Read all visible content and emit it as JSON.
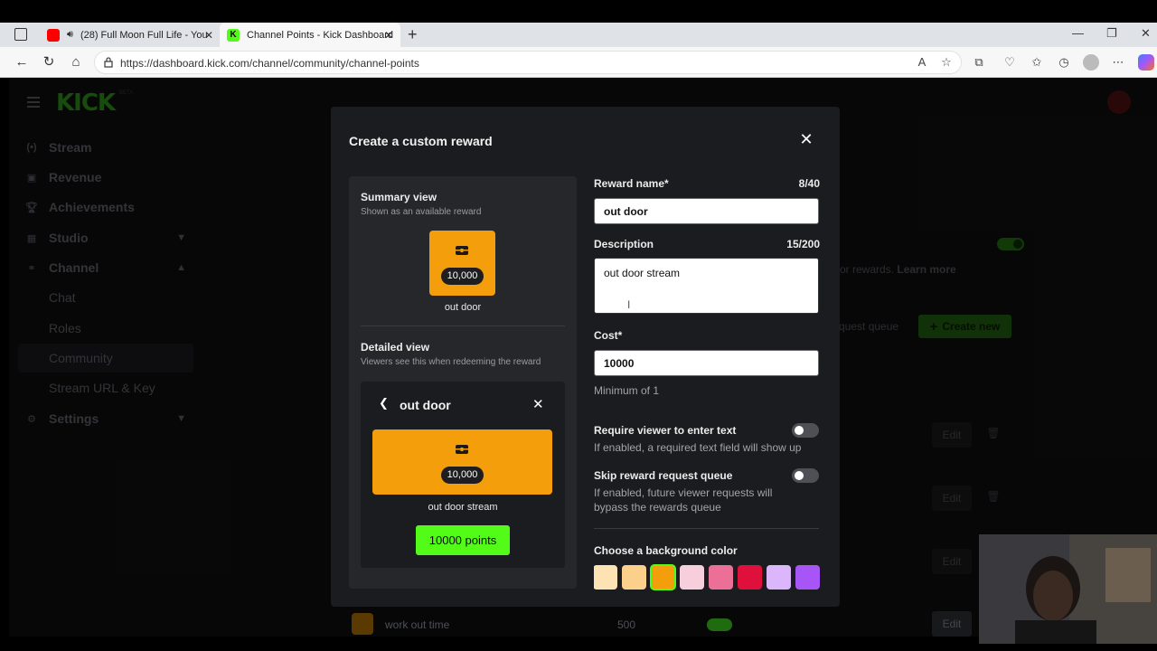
{
  "browser": {
    "tabs": [
      {
        "title": "(28) Full Moon Full Life - You",
        "favicon_color": "#ff0000"
      },
      {
        "title": "Channel Points - Kick Dashboard",
        "favicon_color": "#53fc18"
      }
    ],
    "url": "https://dashboard.kick.com/channel/community/channel-points",
    "new_tab_label": "+"
  },
  "brand": {
    "logo": "KICK",
    "beta": "BETA",
    "accent": "#53fc18"
  },
  "sidebar": {
    "items": [
      {
        "label": "Stream",
        "icon": "broadcast-icon"
      },
      {
        "label": "Revenue",
        "icon": "revenue-icon"
      },
      {
        "label": "Achievements",
        "icon": "trophy-icon"
      },
      {
        "label": "Studio",
        "icon": "studio-icon"
      },
      {
        "label": "Channel",
        "icon": "channel-icon"
      },
      {
        "label": "Chat"
      },
      {
        "label": "Roles"
      },
      {
        "label": "Community"
      },
      {
        "label": "Stream URL & Key"
      },
      {
        "label": "Settings",
        "icon": "gear-icon"
      }
    ]
  },
  "background": {
    "rewards_text": "or rewards.",
    "learn_more": "Learn more",
    "queue_label": "quest queue",
    "create_new": "Create new",
    "edit_label": "Edit",
    "row": {
      "name": "work out time",
      "cost": "500"
    }
  },
  "modal": {
    "title": "Create a custom reward",
    "summary": {
      "heading": "Summary view",
      "subheading": "Shown as an available reward",
      "cost": "10,000",
      "name": "out door"
    },
    "detailed": {
      "heading": "Detailed view",
      "subheading": "Viewers see this when redeeming the reward",
      "title": "out door",
      "cost": "10,000",
      "description": "out door stream",
      "points_button": "10000 points"
    },
    "form": {
      "name_label": "Reward name*",
      "name_count": "8/40",
      "name_value": "out door",
      "desc_label": "Description",
      "desc_count": "15/200",
      "desc_value": "out door stream",
      "cost_label": "Cost*",
      "cost_value": "10000",
      "cost_help": "Minimum of 1",
      "require_text_label": "Require viewer to enter text",
      "require_text_help": "If enabled, a required text field will show up",
      "skip_queue_label": "Skip reward request queue",
      "skip_queue_help": "If enabled, future viewer requests will bypass the rewards queue",
      "color_label": "Choose a background color",
      "colors": [
        "#fde3b3",
        "#fbd08a",
        "#f59e0b",
        "#f7cfdc",
        "#ec6f97",
        "#e0103c",
        "#dcb6fa",
        "#a855f7"
      ],
      "selected_color": "#f59e0b"
    }
  }
}
